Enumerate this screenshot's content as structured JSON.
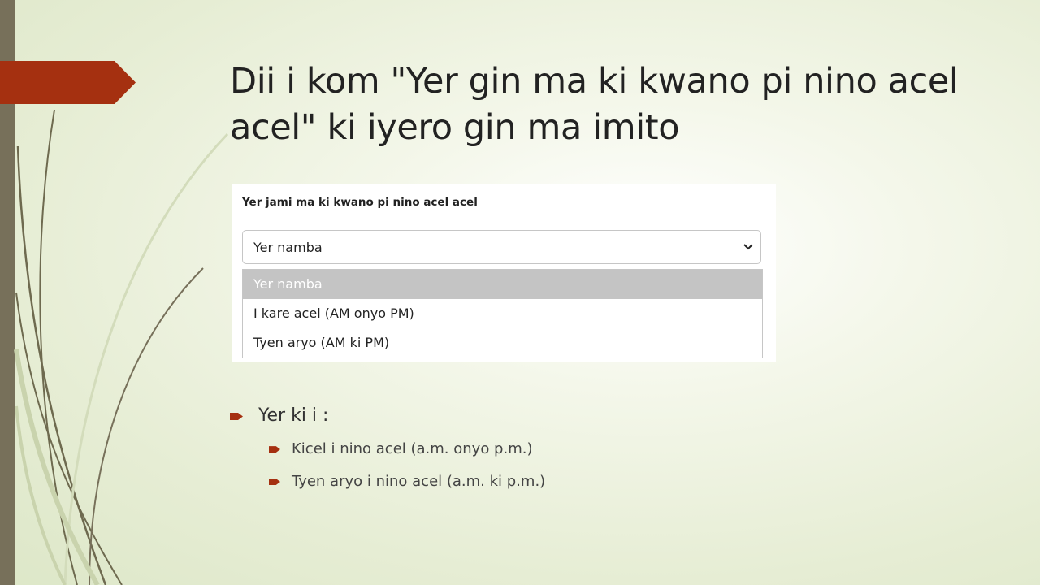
{
  "slide": {
    "title": "Dii i kom \"Yer gin ma ki kwano pi nino acel acel\" ki iyero gin ma imito",
    "colors": {
      "accent": "#a53010",
      "left_bar": "#77705a",
      "text": "#222222"
    }
  },
  "form": {
    "label": "Yer jami ma ki kwano pi nino acel acel",
    "select_value": "Yer namba",
    "options": [
      "Yer namba",
      "I kare acel (AM onyo PM)",
      "Tyen aryo (AM ki PM)"
    ],
    "highlighted_option": "Yer namba"
  },
  "bullets": {
    "main": "Yer ki i :",
    "sub": [
      "Kicel i nino acel (a.m. onyo p.m.)",
      "Tyen aryo i nino acel (a.m. ki p.m.)"
    ],
    "icon": "arrow-bullet-icon"
  }
}
